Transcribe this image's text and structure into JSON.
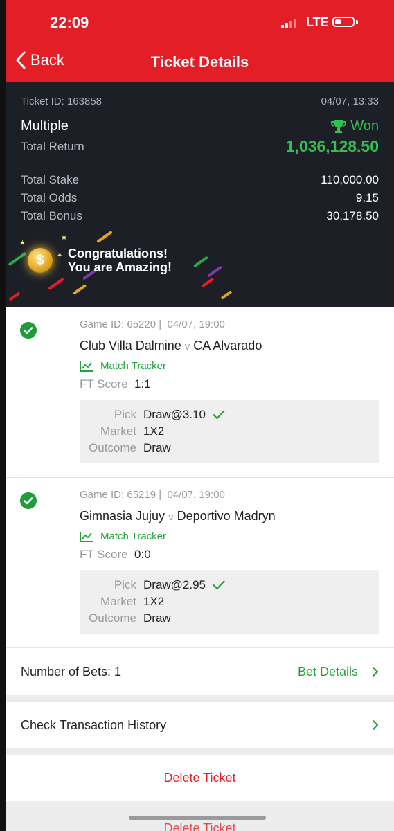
{
  "status_bar": {
    "time": "22:09",
    "network": "LTE"
  },
  "nav": {
    "back_label": "Back",
    "title": "Ticket Details"
  },
  "ticket": {
    "id": "Ticket ID: 163858",
    "datetime": "04/07, 13:33",
    "type": "Multiple",
    "status": "Won",
    "total_return_label": "Total Return",
    "total_return": "1,036,128.50",
    "stats": [
      {
        "label": "Total Stake",
        "value": "110,000.00"
      },
      {
        "label": "Total Odds",
        "value": "9.15"
      },
      {
        "label": "Total Bonus",
        "value": "30,178.50"
      }
    ]
  },
  "banner": {
    "line1": "Congratulations!",
    "line2": "You are Amazing!"
  },
  "games": [
    {
      "game_id": "Game ID: 65220",
      "datetime": "04/07, 19:00",
      "home": "Club Villa Dalmine",
      "away": "CA Alvarado",
      "tracker": "Match Tracker",
      "score_label": "FT Score",
      "score": "1:1",
      "pick_label": "Pick",
      "pick": "Draw@3.10",
      "market_label": "Market",
      "market": "1X2",
      "outcome_label": "Outcome",
      "outcome": "Draw"
    },
    {
      "game_id": "Game ID: 65219",
      "datetime": "04/07, 19:00",
      "home": "Gimnasia Jujuy",
      "away": "Deportivo Madryn",
      "tracker": "Match Tracker",
      "score_label": "FT Score",
      "score": "0:0",
      "pick_label": "Pick",
      "pick": "Draw@2.95",
      "market_label": "Market",
      "market": "1X2",
      "outcome_label": "Outcome",
      "outcome": "Draw"
    }
  ],
  "versus": "v",
  "bets": {
    "label": "Number of Bets: 1",
    "link": "Bet Details"
  },
  "history": {
    "label": "Check Transaction History"
  },
  "delete": {
    "label": "Delete Ticket"
  },
  "colors": {
    "brand_red": "#e41e26",
    "win_green": "#33c24d",
    "dark_bg": "#1c1f26"
  },
  "icons": [
    "signal-icon",
    "battery-icon",
    "back-chevron-icon",
    "trophy-icon",
    "coin-icon",
    "check-circle-icon",
    "chart-icon",
    "checkmark-icon",
    "chevron-right-icon"
  ]
}
